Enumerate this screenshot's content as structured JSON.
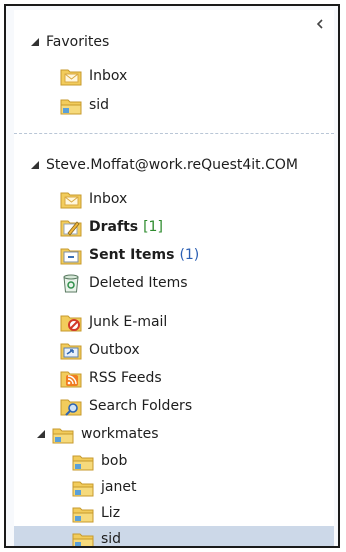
{
  "favorites": {
    "header": "Favorites",
    "items": [
      {
        "label": "Inbox",
        "icon": "inbox-icon"
      },
      {
        "label": "sid",
        "icon": "folder-icon"
      }
    ]
  },
  "account": {
    "header": "Steve.Moffat@work.reQuest4it.COM",
    "items": [
      {
        "label": "Inbox",
        "icon": "inbox-icon"
      },
      {
        "label": "Drafts",
        "count": "[1]",
        "icon": "drafts-icon"
      },
      {
        "label": "Sent Items",
        "count": "(1)",
        "icon": "sent-items-icon"
      },
      {
        "label": "Deleted Items",
        "icon": "deleted-items-icon"
      },
      {
        "label": "Junk E-mail",
        "icon": "junk-email-icon"
      },
      {
        "label": "Outbox",
        "icon": "outbox-icon"
      },
      {
        "label": "RSS Feeds",
        "icon": "rss-feeds-icon"
      },
      {
        "label": "Search Folders",
        "icon": "search-folders-icon"
      }
    ],
    "workmates": {
      "label": "workmates",
      "children": [
        {
          "label": "bob"
        },
        {
          "label": "janet"
        },
        {
          "label": "Liz"
        },
        {
          "label": "sid",
          "selected": true
        }
      ]
    }
  },
  "colors": {
    "selected_row": "#ccd8e8",
    "folder_yellow": "#f2cc5c",
    "count_green": "#2e8b2e",
    "count_blue": "#2b5fb3"
  }
}
